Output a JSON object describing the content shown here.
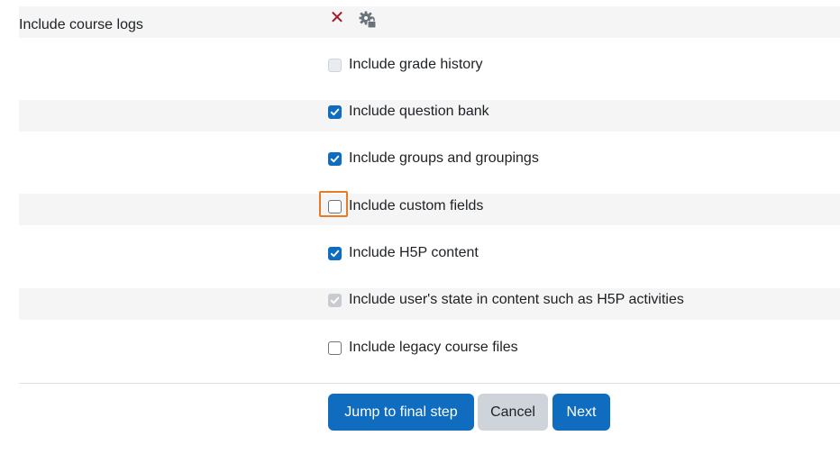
{
  "field": {
    "label": "Include course logs",
    "icons": [
      "close-icon",
      "lock-gear-icon"
    ]
  },
  "options": [
    {
      "label": "Include grade history",
      "checked": false,
      "disabled": true
    },
    {
      "label": "Include question bank",
      "checked": true,
      "disabled": false
    },
    {
      "label": "Include groups and groupings",
      "checked": true,
      "disabled": false
    },
    {
      "label": "Include custom fields",
      "checked": false,
      "disabled": false,
      "focused": true
    },
    {
      "label": "Include H5P content",
      "checked": true,
      "disabled": false
    },
    {
      "label": "Include user's state in content such as H5P activities",
      "checked": true,
      "disabled": true
    },
    {
      "label": "Include legacy course files",
      "checked": false,
      "disabled": false
    }
  ],
  "buttons": {
    "jump": "Jump to final step",
    "cancel": "Cancel",
    "next": "Next"
  },
  "colors": {
    "primary": "#0f6cbf",
    "secondary": "#ced4da",
    "focus": "#e87b25",
    "close": "#a1182e"
  }
}
